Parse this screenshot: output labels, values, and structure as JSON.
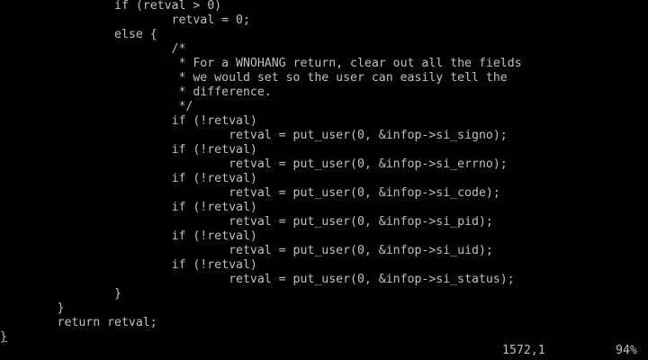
{
  "editor": {
    "lines": [
      "                if (retval > 0)",
      "                        retval = 0;",
      "                else {",
      "                        /*",
      "                         * For a WNOHANG return, clear out all the fields",
      "                         * we would set so the user can easily tell the",
      "                         * difference.",
      "                         */",
      "                        if (!retval)",
      "                                retval = put_user(0, &infop->si_signo);",
      "                        if (!retval)",
      "                                retval = put_user(0, &infop->si_errno);",
      "                        if (!retval)",
      "                                retval = put_user(0, &infop->si_code);",
      "                        if (!retval)",
      "                                retval = put_user(0, &infop->si_pid);",
      "                        if (!retval)",
      "                                retval = put_user(0, &infop->si_uid);",
      "                        if (!retval)",
      "                                retval = put_user(0, &infop->si_status);",
      "                }",
      "        }",
      "        return retval;"
    ],
    "cursor_line": "}"
  },
  "status": {
    "position": "1572,1",
    "percent": "94%"
  },
  "colors": {
    "background": "#000000",
    "foreground": "#c0c0c0"
  }
}
